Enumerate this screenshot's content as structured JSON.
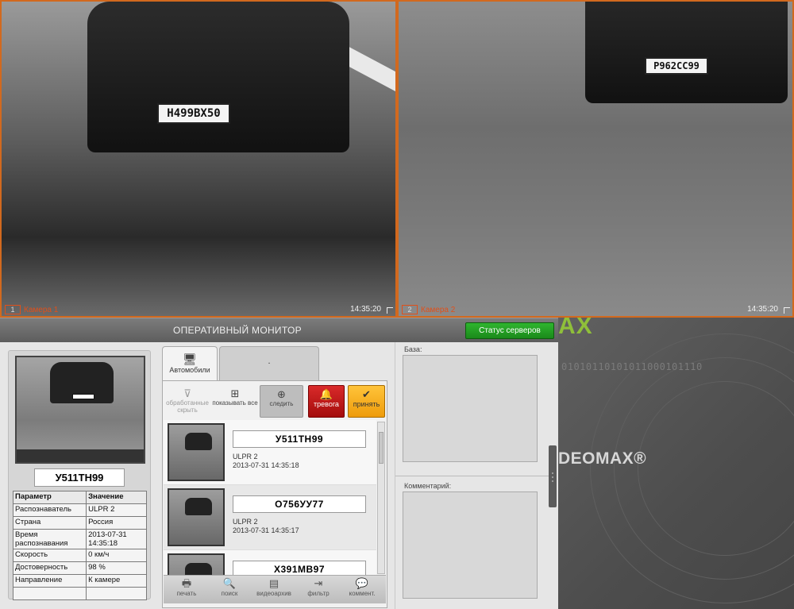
{
  "cameras": [
    {
      "number": "1",
      "label": "Камера 1",
      "time": "14:35:20",
      "plate": "Н499ВХ50"
    },
    {
      "number": "2",
      "label": "Камера 2",
      "time": "14:35:20",
      "plate": "Р962СС99"
    }
  ],
  "monitor": {
    "title": "ОПЕРАТИВНЫЙ МОНИТОР",
    "server_status_button": "Статус серверов"
  },
  "selected": {
    "plate": "У511ТН99",
    "params_header": {
      "param": "Параметр",
      "value": "Значение"
    },
    "params": [
      {
        "name": "Распознаватель",
        "value": "ULPR 2"
      },
      {
        "name": "Страна",
        "value": "Россия"
      },
      {
        "name": "Время распознавания",
        "value": "2013-07-31 14:35:18"
      },
      {
        "name": "Скорость",
        "value": "0 км/ч"
      },
      {
        "name": "Достоверность",
        "value": "98 %"
      },
      {
        "name": "Направление",
        "value": "К камере"
      }
    ]
  },
  "tabs": [
    {
      "label": "Автомобили",
      "icon": "monitor-icon"
    },
    {
      "label": "."
    }
  ],
  "toolbar": {
    "hide_processed": "обработанные скрыть",
    "show_all": "показывать все",
    "follow": "следить",
    "alarm": "тревога",
    "accept": "принять"
  },
  "recognitions": [
    {
      "plate": "У511ТН99",
      "source": "ULPR 2",
      "time": "2013-07-31 14:35:18"
    },
    {
      "plate": "О756УУ77",
      "source": "ULPR 2",
      "time": "2013-07-31 14:35:17"
    },
    {
      "plate": "Х391МВ97",
      "source": "",
      "time": ""
    }
  ],
  "bottom_bar": {
    "print": "печать",
    "search": "поиск",
    "video_archive": "видеоархив",
    "filter": "фильтр",
    "comment": "коммент."
  },
  "right_panel": {
    "base_label": "База:",
    "comment_label": "Комментарий:"
  },
  "background": {
    "logo_top": "AX",
    "binary": "01010110101011000101110",
    "logo_mid": "DEOMAX®"
  },
  "colors": {
    "camera_border": "#d2691e",
    "server_button": "#2fb52f",
    "alarm": "#c41a1a",
    "accept": "#f5b021",
    "logo_green": "#8fbf3a"
  }
}
